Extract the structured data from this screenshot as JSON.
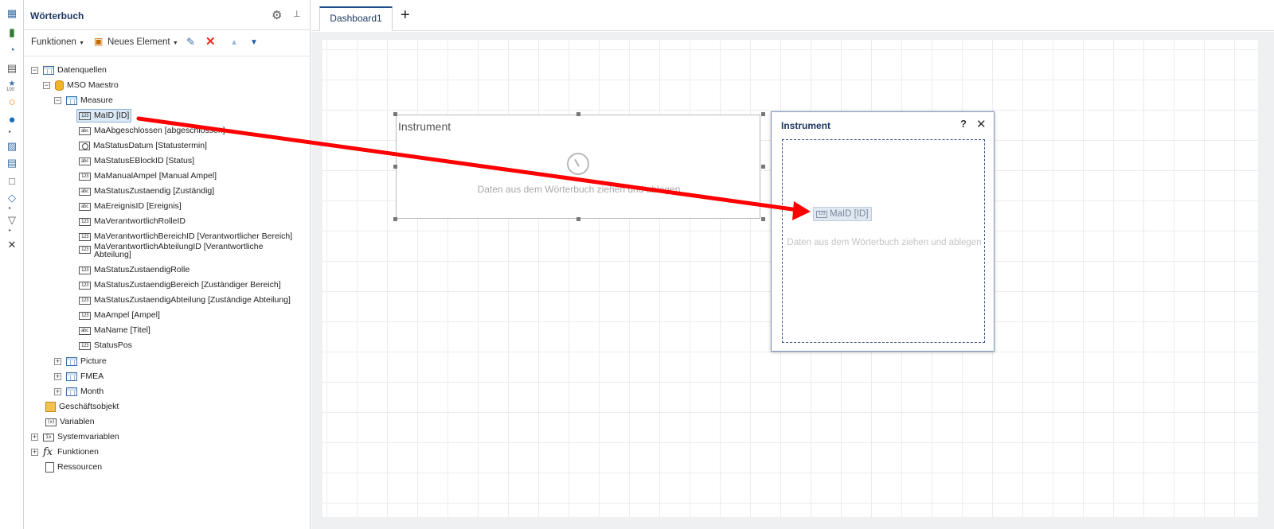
{
  "toolbox": {
    "icons": [
      "table-icon",
      "bar-chart-icon",
      "gauge-icon",
      "document-icon",
      "star-indicator-icon",
      "ring-icon",
      "globe-icon",
      "image-icon",
      "text-icon",
      "rectangle-icon",
      "shapes-icon",
      "filter-icon",
      "tools-icon"
    ],
    "indicator_caption": "100"
  },
  "dictionary": {
    "title": "Wörterbuch",
    "toolbar": {
      "functions_label": "Funktionen",
      "new_element_label": "Neues Element"
    },
    "tree": {
      "datasources": "Datenquellen",
      "connection": "MSO Maestro",
      "measure": "Measure",
      "fields": [
        {
          "type": "123",
          "label": "MaID [ID]"
        },
        {
          "type": "abc",
          "label": "MaAbgeschlossen [abgeschlossen]"
        },
        {
          "type": "clock",
          "label": "MaStatusDatum [Statustermin]"
        },
        {
          "type": "abc",
          "label": "MaStatusEBlockID [Status]"
        },
        {
          "type": "123",
          "label": "MaManualAmpel [Manual Ampel]"
        },
        {
          "type": "abc",
          "label": "MaStatusZustaendig [Zuständig]"
        },
        {
          "type": "abc",
          "label": "MaEreignisID [Ereignis]"
        },
        {
          "type": "123",
          "label": "MaVerantwortlichRolleID"
        },
        {
          "type": "123",
          "label": "MaVerantwortlichBereichID [Verantwortlicher Bereich]"
        },
        {
          "type": "123",
          "label": "MaVerantwortlichAbteilungID [Verantwortliche"
        },
        {
          "type": "123",
          "label": "MaStatusZustaendigRolle"
        },
        {
          "type": "123",
          "label": "MaStatusZustaendigBereich [Zuständiger Bereich]"
        },
        {
          "type": "123",
          "label": "MaStatusZustaendigAbteilung [Zuständige Abteilung]"
        },
        {
          "type": "123",
          "label": "MaAmpel [Ampel]"
        },
        {
          "type": "abc",
          "label": "MaName [Titel]"
        },
        {
          "type": "123",
          "label": "StatusPos"
        }
      ],
      "field_continuation": "Abteilung]",
      "tables": [
        "Picture",
        "FMEA",
        "Month"
      ],
      "business_objects": "Geschäftsobjekt",
      "variables": "Variablen",
      "system_variables": "Systemvariablen",
      "functions": "Funktionen",
      "resources": "Ressourcen"
    }
  },
  "tabs": {
    "active": "Dashboard1",
    "add": "+"
  },
  "canvas": {
    "instrument": {
      "title": "Instrument",
      "hint": "Daten aus dem Wörterbuch ziehen und ablegen"
    }
  },
  "dialog": {
    "title": "Instrument",
    "help": "?",
    "close": "✕",
    "drop_hint": "Daten aus dem Wörterbuch ziehen und ablegen",
    "dragged_item": "MaID [ID]"
  },
  "colors": {
    "accent": "#1f3864",
    "arrow": "#ff0000",
    "tree_selection": "#dbe8f6"
  }
}
